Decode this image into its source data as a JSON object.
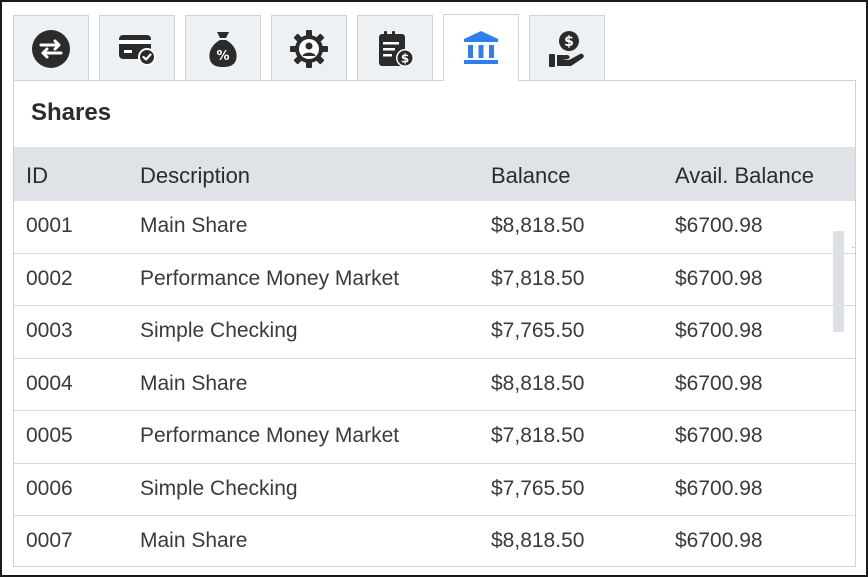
{
  "tabs": [
    {
      "icon": "transfer-icon",
      "active": false
    },
    {
      "icon": "card-check-icon",
      "active": false
    },
    {
      "icon": "money-bag-percent-icon",
      "active": false
    },
    {
      "icon": "gear-user-icon",
      "active": false
    },
    {
      "icon": "statement-dollar-icon",
      "active": false
    },
    {
      "icon": "bank-icon",
      "active": true
    },
    {
      "icon": "hand-dollar-icon",
      "active": false
    }
  ],
  "colors": {
    "accent": "#2f80ed",
    "icon": "#2b2b2b",
    "tab_bg": "#eef1f4",
    "header_bg": "#dfe3e8"
  },
  "panel": {
    "title": "Shares"
  },
  "table": {
    "columns": [
      "ID",
      "Description",
      "Balance",
      "Avail. Balance"
    ],
    "rows": [
      {
        "id": "0001",
        "description": "Main Share",
        "balance": "$8,818.50",
        "avail": "$6700.98"
      },
      {
        "id": "0002",
        "description": "Performance Money Market",
        "balance": "$7,818.50",
        "avail": "$6700.98"
      },
      {
        "id": "0003",
        "description": "Simple Checking",
        "balance": "$7,765.50",
        "avail": "$6700.98"
      },
      {
        "id": "0004",
        "description": "Main Share",
        "balance": "$8,818.50",
        "avail": "$6700.98"
      },
      {
        "id": "0005",
        "description": "Performance Money Market",
        "balance": "$7,818.50",
        "avail": "$6700.98"
      },
      {
        "id": "0006",
        "description": "Simple Checking",
        "balance": "$7,765.50",
        "avail": "$6700.98"
      },
      {
        "id": "0007",
        "description": "Main Share",
        "balance": "$8,818.50",
        "avail": "$6700.98"
      }
    ]
  }
}
